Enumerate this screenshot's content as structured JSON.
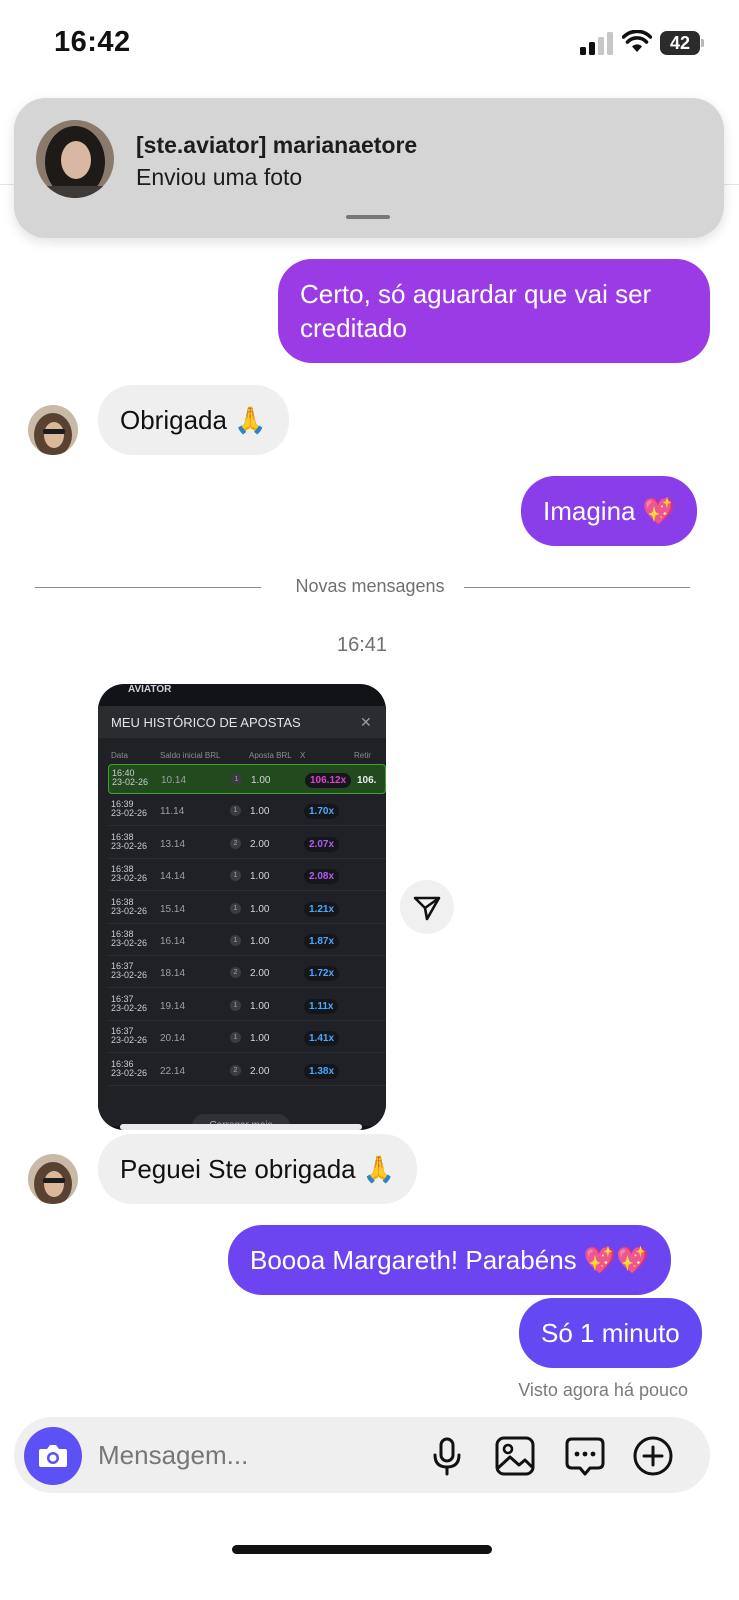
{
  "status_bar": {
    "time": "16:42",
    "battery": "42"
  },
  "notification": {
    "title": "[ste.aviator] marianaetore",
    "subtitle": "Enviou uma foto"
  },
  "messages": [
    {
      "direction": "out",
      "text": "Certo, só aguardar que vai ser creditado"
    },
    {
      "direction": "in",
      "text": "Obrigada 🙏"
    },
    {
      "direction": "out",
      "text": "Imagina 💖"
    },
    {
      "direction": "in",
      "text": "Peguei  Ste obrigada 🙏"
    },
    {
      "direction": "out",
      "text": "Boooa Margareth! Parabéns 💖💖"
    },
    {
      "direction": "out",
      "text": "Só 1 minuto"
    }
  ],
  "divider_label": "Novas mensagens",
  "timestamp": "16:41",
  "shared_photo": {
    "top_label": "AVIATOR",
    "panel_title": "MEU HISTÓRICO DE APOSTAS",
    "columns": [
      "Data",
      "Saldo inicial BRL",
      "Aposta BRL",
      "X",
      "Retir"
    ],
    "rows": [
      {
        "time": "16:40",
        "date": "23-02-26",
        "balance": "10.14",
        "count": "1",
        "bet": "1.00",
        "mult": "106.12x",
        "mult_color": "#e040c8",
        "ret": "106.",
        "highlight": true
      },
      {
        "time": "16:39",
        "date": "23-02-26",
        "balance": "11.14",
        "count": "1",
        "bet": "1.00",
        "mult": "1.70x",
        "mult_color": "#4aa8ff",
        "ret": "",
        "highlight": false
      },
      {
        "time": "16:38",
        "date": "23-02-26",
        "balance": "13.14",
        "count": "2",
        "bet": "2.00",
        "mult": "2.07x",
        "mult_color": "#b15cf0",
        "ret": "",
        "highlight": false
      },
      {
        "time": "16:38",
        "date": "23-02-26",
        "balance": "14.14",
        "count": "1",
        "bet": "1.00",
        "mult": "2.08x",
        "mult_color": "#b15cf0",
        "ret": "",
        "highlight": false
      },
      {
        "time": "16:38",
        "date": "23-02-26",
        "balance": "15.14",
        "count": "1",
        "bet": "1.00",
        "mult": "1.21x",
        "mult_color": "#4aa8ff",
        "ret": "",
        "highlight": false
      },
      {
        "time": "16:38",
        "date": "23-02-26",
        "balance": "16.14",
        "count": "1",
        "bet": "1.00",
        "mult": "1.87x",
        "mult_color": "#4aa8ff",
        "ret": "",
        "highlight": false
      },
      {
        "time": "16:37",
        "date": "23-02-26",
        "balance": "18.14",
        "count": "2",
        "bet": "2.00",
        "mult": "1.72x",
        "mult_color": "#4aa8ff",
        "ret": "",
        "highlight": false
      },
      {
        "time": "16:37",
        "date": "23-02-26",
        "balance": "19.14",
        "count": "1",
        "bet": "1.00",
        "mult": "1.11x",
        "mult_color": "#4aa8ff",
        "ret": "",
        "highlight": false
      },
      {
        "time": "16:37",
        "date": "23-02-26",
        "balance": "20.14",
        "count": "1",
        "bet": "1.00",
        "mult": "1.41x",
        "mult_color": "#4aa8ff",
        "ret": "",
        "highlight": false
      },
      {
        "time": "16:36",
        "date": "23-02-26",
        "balance": "22.14",
        "count": "2",
        "bet": "2.00",
        "mult": "1.38x",
        "mult_color": "#4aa8ff",
        "ret": "",
        "highlight": false
      }
    ],
    "load_more": "Carregar mais"
  },
  "seen_label": "Visto agora há pouco",
  "composer": {
    "placeholder": "Mensagem...",
    "icons": [
      "camera-icon",
      "microphone-icon",
      "gallery-icon",
      "sticker-icon",
      "plus-icon"
    ]
  },
  "colors": {
    "bubble_out_top": "#9a3be6",
    "bubble_out_mid": "#7f3fec",
    "bubble_out_bottom": "#6448f2",
    "bubble_in": "#efefef",
    "camera_button": "#5b51f5"
  }
}
